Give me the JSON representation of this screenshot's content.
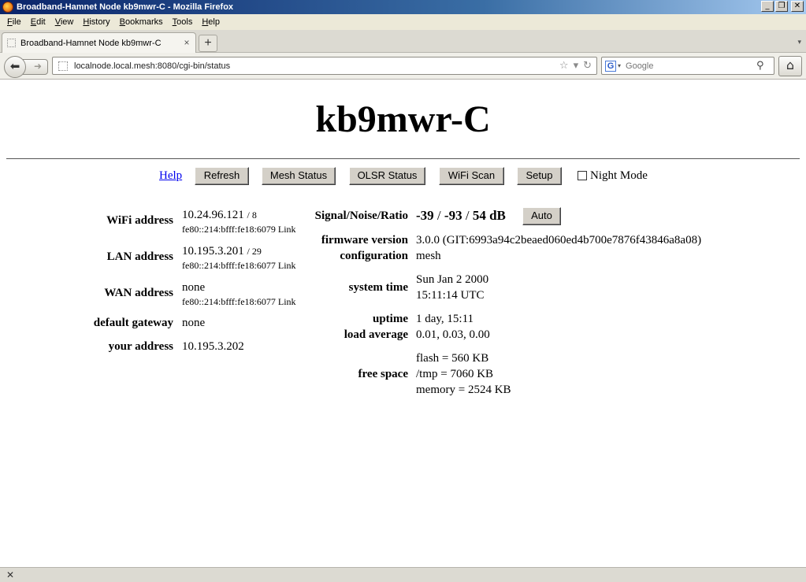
{
  "window": {
    "title": "Broadband-Hamnet Node kb9mwr-C - Mozilla Firefox",
    "controls": {
      "minimize": "_",
      "maximize": "❐",
      "close": "✕"
    }
  },
  "menubar": {
    "items": [
      {
        "label": "File"
      },
      {
        "label": "Edit"
      },
      {
        "label": "View"
      },
      {
        "label": "History"
      },
      {
        "label": "Bookmarks"
      },
      {
        "label": "Tools"
      },
      {
        "label": "Help"
      }
    ]
  },
  "tabs": {
    "active_label": "Broadband-Hamnet Node kb9mwr-C",
    "new_tab": "+"
  },
  "navbar": {
    "url": "localnode.local.mesh:8080/cgi-bin/status",
    "search_placeholder": "Google",
    "search_engine_glyph": "G"
  },
  "page": {
    "node_name": "kb9mwr-C",
    "help_link": "Help",
    "buttons": {
      "refresh": "Refresh",
      "mesh_status": "Mesh Status",
      "olsr_status": "OLSR Status",
      "wifi_scan": "WiFi Scan",
      "setup": "Setup",
      "auto": "Auto"
    },
    "night_mode_label": "Night Mode",
    "left": {
      "wifi_label": "WiFi address",
      "wifi_ip": "10.24.96.121",
      "wifi_mask": "/ 8",
      "wifi_ipv6": "fe80::214:bfff:fe18:6079 Link",
      "lan_label": "LAN address",
      "lan_ip": "10.195.3.201",
      "lan_mask": "/ 29",
      "lan_ipv6": "fe80::214:bfff:fe18:6077 Link",
      "wan_label": "WAN address",
      "wan_ip": "none",
      "wan_ipv6": "fe80::214:bfff:fe18:6077 Link",
      "gateway_label": "default gateway",
      "gateway_value": "none",
      "your_address_label": "your address",
      "your_address_value": "10.195.3.202"
    },
    "right": {
      "snr_label": "Signal/Noise/Ratio",
      "signal": "-39",
      "noise": "-93",
      "ratio": "54 dB",
      "firmware_label": "firmware version",
      "firmware_value": "3.0.0 (GIT:6993a94c2beaed060ed4b700e7876f43846a8a08)",
      "config_label": "configuration",
      "config_value": "mesh",
      "systime_label": "system time",
      "systime_date": "Sun Jan 2 2000",
      "systime_time": "15:11:14 UTC",
      "uptime_label": "uptime",
      "uptime_value": "1 day, 15:11",
      "load_label": "load average",
      "load_value": "0.01, 0.03, 0.00",
      "free_label": "free space",
      "flash": "flash = 560 KB",
      "tmp": "/tmp = 7060 KB",
      "memory": "memory = 2524 KB"
    }
  },
  "statusbar": {
    "close_glyph": "✕"
  }
}
